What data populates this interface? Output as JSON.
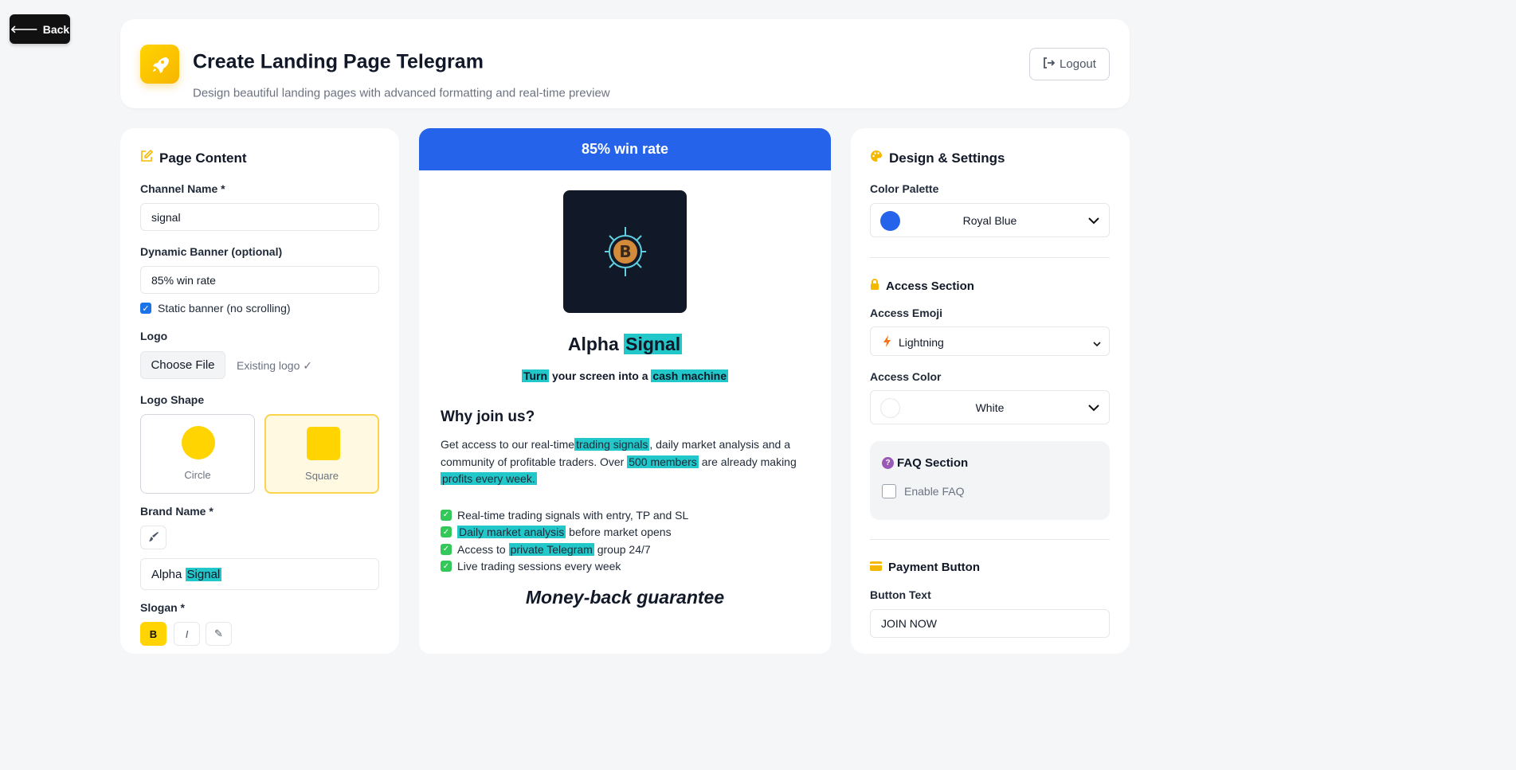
{
  "back_label": "Back",
  "header": {
    "title": "Create Landing Page Telegram",
    "subtitle": "Design beautiful landing pages with advanced formatting and real-time preview",
    "logout_label": "Logout"
  },
  "left_panel": {
    "title": "Page Content",
    "channel_name_label": "Channel Name *",
    "channel_name_value": "signal",
    "banner_label": "Dynamic Banner (optional)",
    "banner_value": "85% win rate",
    "static_banner_label": "Static banner (no scrolling)",
    "static_banner_checked": true,
    "logo_label": "Logo",
    "choose_file_label": "Choose File",
    "logo_status": "Existing logo ✓",
    "logo_shape_label": "Logo Shape",
    "shape_options": [
      "Circle",
      "Square"
    ],
    "selected_shape": "Square",
    "brand_name_label": "Brand Name *",
    "brand_name_plain": "Alpha",
    "brand_name_highlight": "Signal",
    "slogan_label": "Slogan *",
    "slogan_tools": [
      "B",
      "I",
      "✎"
    ]
  },
  "preview": {
    "banner": "85% win rate",
    "brand_plain": "Alpha",
    "brand_highlight": "Signal",
    "slogan_hl1": "Turn",
    "slogan_mid": "your screen into a",
    "slogan_hl2": "cash machine",
    "why_title": "Why join us?",
    "desc_1": "Get access to our real-time",
    "desc_hl1": "trading signals",
    "desc_2": ", daily market analysis and a community of profitable traders. Over",
    "desc_hl2": "500 members",
    "desc_3": "are already making",
    "desc_hl3": "profits every week.",
    "bullet_1": "Real-time trading signals with entry, TP and SL",
    "bullet_2_hl": "Daily market analysis",
    "bullet_2_rest": "before market opens",
    "bullet_3_pre": "Access to",
    "bullet_3_hl": "private Telegram",
    "bullet_3_rest": "group 24/7",
    "bullet_4": "Live trading sessions every week",
    "guarantee": "Money-back guarantee"
  },
  "right_panel": {
    "title": "Design & Settings",
    "palette_label": "Color Palette",
    "palette_value": "Royal Blue",
    "palette_color": "#2563eb",
    "access_section_title": "Access Section",
    "access_emoji_label": "Access Emoji",
    "access_emoji_value": "Lightning",
    "access_color_label": "Access Color",
    "access_color_value": "White",
    "faq_title": "FAQ Section",
    "faq_enable_label": "Enable FAQ",
    "payment_title": "Payment Button",
    "button_text_label": "Button Text",
    "button_text_value": "JOIN NOW"
  },
  "colors": {
    "accent_yellow": "#ffd400",
    "highlight_teal": "#22c7c9",
    "banner_blue": "#2563eb"
  }
}
